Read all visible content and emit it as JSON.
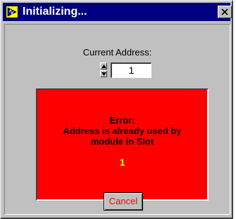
{
  "window": {
    "title": "Initializing...",
    "title_bar_color": "#000080",
    "background_color": "#c0c0c0"
  },
  "address": {
    "label": "Current Address:",
    "value": "1"
  },
  "error": {
    "line1": "Error:",
    "line2": "Address is already used by",
    "line3": "module in Slot",
    "slot": "1",
    "background_color": "#ff0000",
    "slot_color": "#ffff00"
  },
  "buttons": {
    "cancel_label": "Cancel",
    "cancel_text_color": "#ff0000"
  },
  "icons": {
    "title": "labview-app-icon",
    "close": "close-icon",
    "increment": "up-arrow-icon",
    "decrement": "down-arrow-icon"
  }
}
